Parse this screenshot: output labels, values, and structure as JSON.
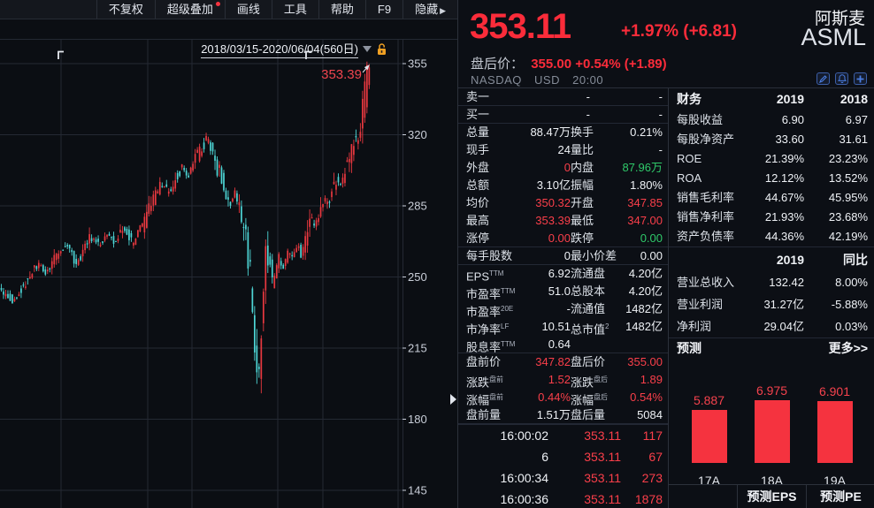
{
  "toolbar": {
    "items": [
      {
        "label": "不复权",
        "badge": false,
        "arrow": false
      },
      {
        "label": "超级叠加",
        "badge": true,
        "arrow": false
      },
      {
        "label": "画线",
        "badge": false,
        "arrow": false
      },
      {
        "label": "工具",
        "badge": false,
        "arrow": false
      },
      {
        "label": "帮助",
        "badge": false,
        "arrow": false
      },
      {
        "label": "F9",
        "badge": false,
        "arrow": false
      },
      {
        "label": "隐藏",
        "badge": false,
        "arrow": true
      }
    ]
  },
  "chart": {
    "range_label": "2018/03/15-2020/06/04(560日)",
    "peak_label": "353.39",
    "y_ticks": [
      355,
      320,
      285,
      250,
      215,
      180,
      145
    ],
    "x_grid": [
      69,
      167,
      217,
      314,
      365,
      450
    ],
    "event_markers": [
      66,
      346
    ],
    "colors": {
      "up": "#e8383f",
      "down": "#4ed6d6",
      "grid": "#242933",
      "axis_text": "#c9ced8",
      "annotation": "#f0454f",
      "arrow": "#dfe3ea"
    },
    "candle_pitch": 2.49,
    "candle_count": 168,
    "keyframes": [
      [
        0,
        247
      ],
      [
        8,
        242
      ],
      [
        18,
        238
      ],
      [
        28,
        246
      ],
      [
        36,
        251
      ],
      [
        46,
        256
      ],
      [
        54,
        252
      ],
      [
        62,
        259
      ],
      [
        72,
        264
      ],
      [
        80,
        266
      ],
      [
        88,
        256
      ],
      [
        97,
        263
      ],
      [
        105,
        270
      ],
      [
        115,
        265
      ],
      [
        124,
        272
      ],
      [
        132,
        267
      ],
      [
        142,
        274
      ],
      [
        152,
        266
      ],
      [
        160,
        272
      ],
      [
        168,
        279
      ],
      [
        176,
        289
      ],
      [
        185,
        296
      ],
      [
        193,
        291
      ],
      [
        200,
        299
      ],
      [
        208,
        304
      ],
      [
        215,
        299
      ],
      [
        222,
        307
      ],
      [
        230,
        313
      ],
      [
        237,
        318
      ],
      [
        243,
        311
      ],
      [
        250,
        301
      ],
      [
        256,
        293
      ],
      [
        262,
        286
      ],
      [
        268,
        293
      ],
      [
        274,
        282
      ],
      [
        280,
        270
      ],
      [
        285,
        254
      ],
      [
        290,
        222
      ],
      [
        294,
        196
      ],
      [
        298,
        224
      ],
      [
        302,
        258
      ],
      [
        306,
        262
      ],
      [
        310,
        247
      ],
      [
        314,
        252
      ],
      [
        318,
        260
      ],
      [
        323,
        255
      ],
      [
        328,
        263
      ],
      [
        333,
        258
      ],
      [
        338,
        266
      ],
      [
        343,
        261
      ],
      [
        348,
        270
      ],
      [
        353,
        279
      ],
      [
        358,
        275
      ],
      [
        363,
        283
      ],
      [
        368,
        289
      ],
      [
        373,
        285
      ],
      [
        378,
        294
      ],
      [
        383,
        299
      ],
      [
        388,
        295
      ],
      [
        393,
        304
      ],
      [
        398,
        311
      ],
      [
        403,
        318
      ],
      [
        406,
        315
      ],
      [
        409,
        324
      ],
      [
        412,
        331
      ],
      [
        415,
        340
      ],
      [
        418,
        353
      ]
    ]
  },
  "header": {
    "name": "阿斯麦",
    "symbol": "ASML",
    "price": "353.11",
    "change": "+1.97% (+6.81)",
    "after_label": "盘后价：",
    "after_value": "355.00 +0.54% (+1.89)",
    "exchange": "NASDAQ",
    "currency": "USD",
    "time": "20:00"
  },
  "orderbook": [
    {
      "label": "卖一",
      "price": "-",
      "vol": "-"
    },
    {
      "label": "买一",
      "price": "-",
      "vol": "-"
    }
  ],
  "quote_rows": [
    {
      "l": "总量",
      "sup": "",
      "v": "88.47万",
      "c": "w",
      "l2": "换手",
      "sup2": "",
      "v2": "0.21%",
      "c2": "w",
      "sepAfter": false
    },
    {
      "l": "现手",
      "sup": "",
      "v": "24",
      "c": "w",
      "l2": "量比",
      "sup2": "",
      "v2": "-",
      "c2": "w",
      "sepAfter": false
    },
    {
      "l": "外盘",
      "sup": "",
      "v": "0",
      "c": "r",
      "l2": "内盘",
      "sup2": "",
      "v2": "87.96万",
      "c2": "g",
      "sepAfter": false
    },
    {
      "l": "总额",
      "sup": "",
      "v": "3.10亿",
      "c": "w",
      "l2": "振幅",
      "sup2": "",
      "v2": "1.80%",
      "c2": "w",
      "sepAfter": false
    },
    {
      "l": "均价",
      "sup": "",
      "v": "350.32",
      "c": "r",
      "l2": "开盘",
      "sup2": "",
      "v2": "347.85",
      "c2": "r",
      "sepAfter": false
    },
    {
      "l": "最高",
      "sup": "",
      "v": "353.39",
      "c": "r",
      "l2": "最低",
      "sup2": "",
      "v2": "347.00",
      "c2": "r",
      "sepAfter": false
    },
    {
      "l": "涨停",
      "sup": "",
      "v": "0.00",
      "c": "r",
      "l2": "跌停",
      "sup2": "",
      "v2": "0.00",
      "c2": "g",
      "sepAfter": true
    },
    {
      "l": "每手股数",
      "sup": "",
      "v": "0",
      "c": "w",
      "l2": "最小价差",
      "sup2": "",
      "v2": "0.00",
      "c2": "w",
      "sepAfter": true
    },
    {
      "l": "EPS",
      "sup": "TTM",
      "v": "6.92",
      "c": "w",
      "l2": "流通盘",
      "sup2": "",
      "v2": "4.20亿",
      "c2": "w",
      "sepAfter": false
    },
    {
      "l": "市盈率",
      "sup": "TTM",
      "v": "51.0",
      "c": "w",
      "l2": "总股本",
      "sup2": "",
      "v2": "4.20亿",
      "c2": "w",
      "sepAfter": false
    },
    {
      "l": "市盈率",
      "sup": "20E",
      "v": "-",
      "c": "w",
      "l2": "流通值",
      "sup2": "",
      "v2": "1482亿",
      "c2": "w",
      "sepAfter": false
    },
    {
      "l": "市净率",
      "sup": "LF",
      "v": "10.51",
      "c": "w",
      "l2": "总市值",
      "sup2": "2",
      "v2": "1482亿",
      "c2": "w",
      "sepAfter": false
    },
    {
      "l": "股息率",
      "sup": "TTM",
      "v": "0.64",
      "c": "w",
      "l2": "",
      "sup2": "",
      "v2": "",
      "c2": "w",
      "sepAfter": true
    },
    {
      "l": "盘前价",
      "sup": "",
      "v": "347.82",
      "c": "r",
      "l2": "盘后价",
      "sup2": "",
      "v2": "355.00",
      "c2": "r",
      "sepAfter": false
    },
    {
      "l": "涨跌",
      "sup": "盘前",
      "v": "1.52",
      "c": "r",
      "l2": "涨跌",
      "sup2": "盘后",
      "v2": "1.89",
      "c2": "r",
      "sepAfter": false
    },
    {
      "l": "涨幅",
      "sup": "盘前",
      "v": "0.44%",
      "c": "r",
      "l2": "涨幅",
      "sup2": "盘后",
      "v2": "0.54%",
      "c2": "r",
      "sepAfter": false
    },
    {
      "l": "盘前量",
      "sup": "",
      "v": "1.51万",
      "c": "w",
      "l2": "盘后量",
      "sup2": "",
      "v2": "5084",
      "c2": "w",
      "sepAfter": true
    }
  ],
  "ticks": [
    {
      "time": "16:00:02",
      "price": "353.11",
      "vol": "117"
    },
    {
      "time": "6",
      "price": "353.11",
      "vol": "67"
    },
    {
      "time": "16:00:34",
      "price": "353.11",
      "vol": "273"
    },
    {
      "time": "16:00:36",
      "price": "353.11",
      "vol": "1878"
    }
  ],
  "finance": {
    "title": "财务",
    "col1": "2019",
    "col2": "2018",
    "rows": [
      [
        "每股收益",
        "6.90",
        "6.97"
      ],
      [
        "每股净资产",
        "33.60",
        "31.61"
      ],
      [
        "ROE",
        "21.39%",
        "23.23%"
      ],
      [
        "ROA",
        "12.12%",
        "13.52%"
      ],
      [
        "销售毛利率",
        "44.67%",
        "45.95%"
      ],
      [
        "销售净利率",
        "21.93%",
        "23.68%"
      ],
      [
        "资产负债率",
        "44.36%",
        "42.19%"
      ]
    ]
  },
  "growth": {
    "col1": "2019",
    "col2": "同比",
    "rows": [
      {
        "l": "营业总收入",
        "v": "132.42",
        "yoy": "8.00%",
        "c": "r"
      },
      {
        "l": "营业利润",
        "v": "31.27亿",
        "yoy": "-5.88%",
        "c": "g"
      },
      {
        "l": "净利润",
        "v": "29.04亿",
        "yoy": "0.03%",
        "c": "r"
      }
    ]
  },
  "forecast": {
    "title": "预测",
    "more": "更多>>",
    "bars": [
      {
        "label": "17A",
        "value": 5.887
      },
      {
        "label": "18A",
        "value": 6.975
      },
      {
        "label": "19A",
        "value": 6.901
      }
    ],
    "tabs": [
      "预测EPS",
      "预测PE"
    ],
    "bar_color": "#f5333f"
  }
}
